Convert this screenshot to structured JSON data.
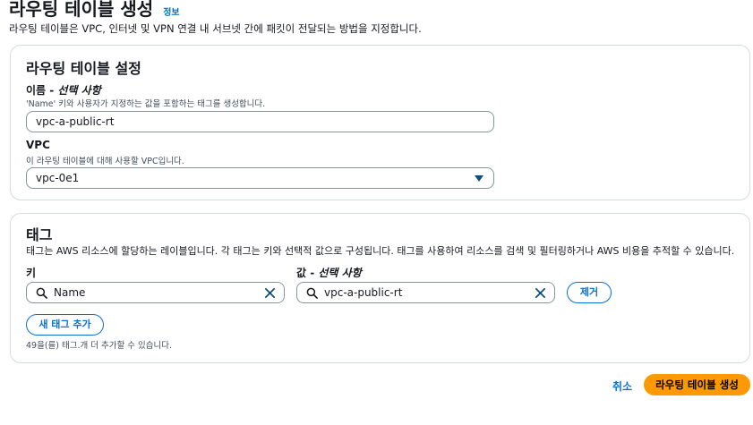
{
  "header": {
    "title": "라우팅 테이블 생성",
    "info_link": "정보",
    "description": "라우팅 테이블은 VPC, 인터넷 및 VPN 연결 내 서브넷 간에 패킷이 전달되는 방법을 지정합니다."
  },
  "settings": {
    "title": "라우팅 테이블 설정",
    "name": {
      "label": "이름 - ",
      "optional": "선택 사항",
      "hint": "'Name' 키와 사용자가 지정하는 값을 포함하는 태그를 생성합니다.",
      "value": "vpc-a-public-rt"
    },
    "vpc": {
      "label": "VPC",
      "hint": "이 라우팅 테이블에 대해 사용할 VPC입니다.",
      "value": "vpc-0e1"
    }
  },
  "tags": {
    "title": "태그",
    "description": "태그는 AWS 리소스에 할당하는 레이블입니다. 각 태그는 키와 선택적 값으로 구성됩니다. 태그를 사용하여 리소스를 검색 및 필터링하거나 AWS 비용을 추적할 수 있습니다.",
    "key_label": "키",
    "value_label": "값 - ",
    "value_optional": "선택 사항",
    "rows": [
      {
        "key": "Name",
        "value": "vpc-a-public-rt",
        "remove_label": "제거"
      }
    ],
    "add_label": "새 태그 추가",
    "remaining_note": "49을(를) 태그.개 더 추가할 수 있습니다."
  },
  "footer": {
    "cancel_label": "취소",
    "create_label": "라우팅 테이블 생성"
  }
}
